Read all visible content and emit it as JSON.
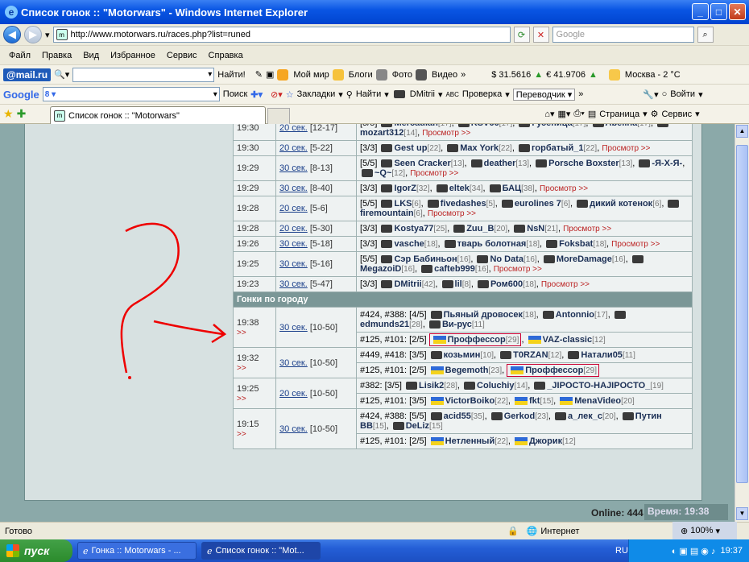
{
  "window": {
    "title": "Список гонок :: \"Motorwars\" - Windows Internet Explorer"
  },
  "address": {
    "url": "http://www.motorwars.ru/races.php?list=runed",
    "search_placeholder": "Google"
  },
  "menu": [
    "Файл",
    "Правка",
    "Вид",
    "Избранное",
    "Сервис",
    "Справка"
  ],
  "toolbar1": {
    "mail_logo": "@mail.ru",
    "find": "Найти!",
    "moi_mir": "Мой мир",
    "blogs": "Блоги",
    "photo": "Фото",
    "video": "Видео",
    "usd": "$ 31.5616",
    "eur": "€ 41.9706",
    "weather": "Москва - 2 °C"
  },
  "toolbar2": {
    "google": "Google",
    "search": "Поиск",
    "bookmarks": "Закладки",
    "find": "Найти",
    "dmitrii": "DMitrii",
    "check": "Проверка",
    "translate": "Переводчик",
    "login": "Войти"
  },
  "tab": {
    "label": "Список гонок :: \"Motorwars\""
  },
  "toolbar3": {
    "page": "Страница",
    "service": "Сервис"
  },
  "races": [
    {
      "time": "19:30",
      "link": "20 сек.",
      "range": "[12-17]",
      "desc": [
        {
          "t": "[5/5] "
        },
        {
          "p": "Mercadian",
          "l": "[17]"
        },
        {
          "p": "KSV66",
          "l": "[17]"
        },
        {
          "p": "Гусеница",
          "l": "[17]"
        },
        {
          "p": "Abelina",
          "l": "[17]"
        },
        {
          "p": "mozart312",
          "l": "[14]"
        }
      ]
    },
    {
      "time": "19:30",
      "link": "20 сек.",
      "range": "[5-22]",
      "desc": [
        {
          "t": "[3/3] "
        },
        {
          "p": "Gest up",
          "l": "[22]"
        },
        {
          "p": "Max York",
          "l": "[22]"
        },
        {
          "p": "горбатый_1",
          "l": "[22]"
        }
      ]
    },
    {
      "time": "19:29",
      "link": "30 сек.",
      "range": "[8-13]",
      "desc": [
        {
          "t": "[5/5] "
        },
        {
          "p": "Seen Cracker",
          "l": "[13]"
        },
        {
          "p": "deather",
          "l": "[13]"
        },
        {
          "p": "Porsche Boxster",
          "l": "[13]"
        },
        {
          "p": "-Я-Х-Я-",
          "l": ""
        },
        {
          "p": "~Q~",
          "l": "[12]"
        }
      ]
    },
    {
      "time": "19:29",
      "link": "30 сек.",
      "range": "[8-40]",
      "desc": [
        {
          "t": "[3/3] "
        },
        {
          "p": "IgorZ",
          "l": "[32]"
        },
        {
          "p": "eltek",
          "l": "[34]"
        },
        {
          "p": "БАЦ",
          "l": "[38]"
        }
      ]
    },
    {
      "time": "19:28",
      "link": "20 сек.",
      "range": "[5-6]",
      "desc": [
        {
          "t": "[5/5] "
        },
        {
          "p": "LKS",
          "l": "[6]"
        },
        {
          "p": "fivedashes",
          "l": "[5]"
        },
        {
          "p": "eurolines 7",
          "l": "[6]"
        },
        {
          "p": "дикий котенок",
          "l": "[6]"
        },
        {
          "p": "firemountain",
          "l": "[6]"
        }
      ]
    },
    {
      "time": "19:28",
      "link": "20 сек.",
      "range": "[5-30]",
      "desc": [
        {
          "t": "[3/3] "
        },
        {
          "p": "Kostya77",
          "l": "[25]"
        },
        {
          "p": "Zuu_B",
          "l": "[20]"
        },
        {
          "p": "NsN",
          "l": "[21]"
        }
      ]
    },
    {
      "time": "19:26",
      "link": "30 сек.",
      "range": "[5-18]",
      "desc": [
        {
          "t": "[3/3] "
        },
        {
          "p": "vasche",
          "l": "[18]"
        },
        {
          "p": "тварь болотная",
          "l": "[18]"
        },
        {
          "p": "Foksbat",
          "l": "[18]"
        }
      ]
    },
    {
      "time": "19:25",
      "link": "30 сек.",
      "range": "[5-16]",
      "desc": [
        {
          "t": "[5/5] "
        },
        {
          "p": "Сэр Бабиньон",
          "l": "[16]"
        },
        {
          "p": "No Data",
          "l": "[16]"
        },
        {
          "p": "MoreDamage",
          "l": "[16]"
        },
        {
          "p": "MegazoiD",
          "l": "[16]"
        },
        {
          "p": "caftеb999",
          "l": "[16]"
        }
      ]
    },
    {
      "time": "19:23",
      "link": "30 сек.",
      "range": "[5-47]",
      "desc": [
        {
          "t": "[3/3] "
        },
        {
          "p": "DMitrii",
          "l": "[42]"
        },
        {
          "p": "lil",
          "l": "[8]"
        },
        {
          "p": "Ром600",
          "l": "[18]"
        }
      ]
    }
  ],
  "preview": "Просмотр >>",
  "section_city": "Гонки по городу",
  "city_races": [
    {
      "time": "19:38",
      "link": "30 сек.",
      "range": "[10-50]",
      "a": [
        {
          "t": "#424, #388: [4/5] "
        },
        {
          "p": "Пьяный дровосек",
          "l": "[18]"
        },
        {
          "p": "Antonnio",
          "l": "[17]"
        },
        {
          "p": "edmunds21",
          "l": "[28]"
        },
        {
          "p": "Ви-рус",
          "l": "[11]"
        }
      ],
      "b": [
        {
          "t": "#125, #101: [2/5] "
        },
        {
          "p": "Проффессор",
          "l": "[29]",
          "hl": true
        },
        {
          "p": "VAZ-classic",
          "l": "[12]"
        }
      ]
    },
    {
      "time": "19:32",
      "link": "30 сек.",
      "range": "[10-50]",
      "a": [
        {
          "t": "#449, #418: [3/5] "
        },
        {
          "p": "козьмин",
          "l": "[10]"
        },
        {
          "p": "T0RZAN",
          "l": "[12]"
        },
        {
          "p": "Натали05",
          "l": "[11]"
        }
      ],
      "b": [
        {
          "t": "#125, #101: [2/5] "
        },
        {
          "p": "Begemoth",
          "l": "[23]"
        },
        {
          "p": "Проффессор",
          "l": "[29]",
          "hl": true
        }
      ]
    },
    {
      "time": "19:25",
      "link": "20 сек.",
      "range": "[10-50]",
      "a": [
        {
          "t": "#382: [3/5] "
        },
        {
          "p": "Lisik2",
          "l": "[28]"
        },
        {
          "p": "Coluchiy",
          "l": "[14]"
        },
        {
          "p": "_JIPOCTO-HAJIPOCTO_",
          "l": "[19]"
        }
      ],
      "b": [
        {
          "t": "#125, #101: [3/5] "
        },
        {
          "p": "VictorBoiko",
          "l": "[22]"
        },
        {
          "p": "fkt",
          "l": "[15]"
        },
        {
          "p": "MenaVideo",
          "l": "[20]"
        }
      ]
    },
    {
      "time": "19:15",
      "link": "30 сек.",
      "range": "[10-50]",
      "a": [
        {
          "t": "#424, #388: [5/5] "
        },
        {
          "p": "acid55",
          "l": "[35]"
        },
        {
          "p": "Gerkod",
          "l": "[23]"
        },
        {
          "p": "a_лек_с",
          "l": "[20]"
        },
        {
          "p": "Путин BB",
          "l": "[15]"
        },
        {
          "p": "DeLiz",
          "l": "[15]"
        }
      ],
      "b": [
        {
          "t": "#125, #101: [2/5] "
        },
        {
          "p": "Нетленный",
          "l": "[22]"
        },
        {
          "p": "Джорик",
          "l": "[12]"
        }
      ]
    }
  ],
  "footer": {
    "online": "Online: 444",
    "time": "Время: 19:38"
  },
  "status": {
    "ready": "Готово",
    "zone": "Интернет",
    "zoom": "100%"
  },
  "taskbar": {
    "start": "пуск",
    "task1": "Гонка :: Motorwars - ...",
    "task2": "Список гонок :: \"Mot...",
    "lang": "RU",
    "clock": "19:37"
  }
}
